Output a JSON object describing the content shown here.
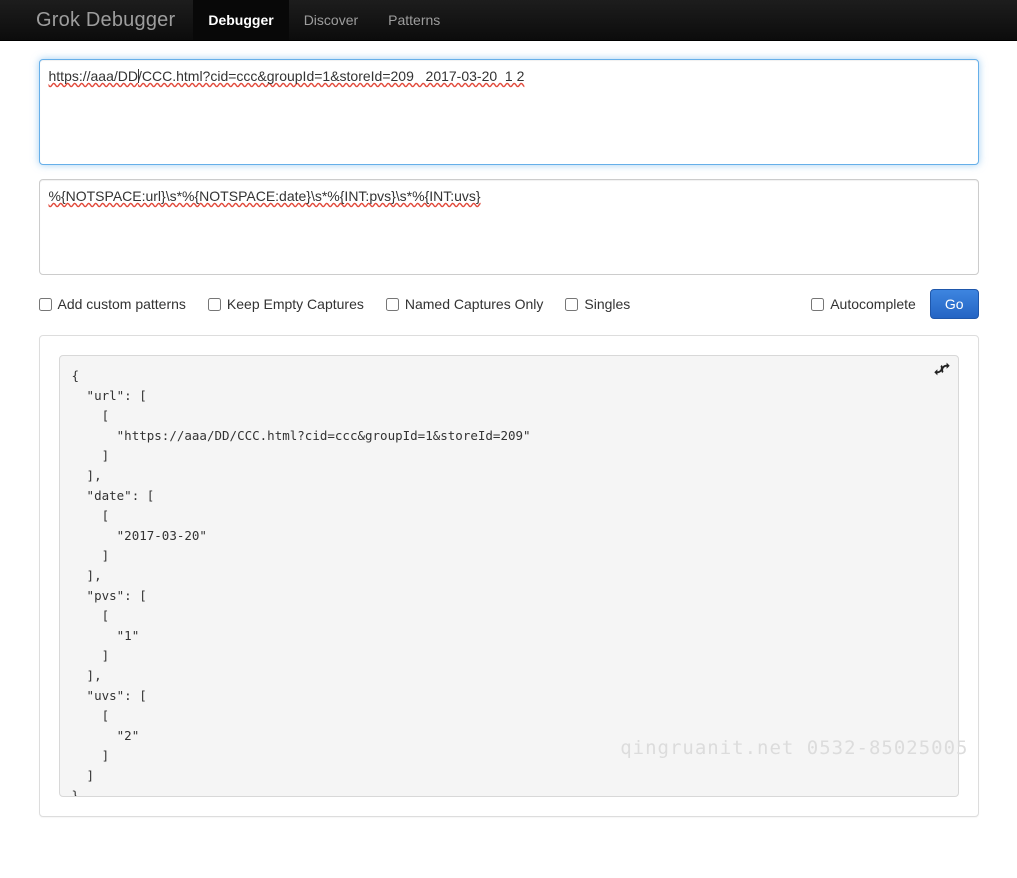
{
  "navbar": {
    "brand": "Grok Debugger",
    "tabs": [
      {
        "label": "Debugger",
        "active": true
      },
      {
        "label": "Discover",
        "active": false
      },
      {
        "label": "Patterns",
        "active": false
      }
    ]
  },
  "input_area": {
    "name": "sample-input-textarea",
    "value_before_caret": "https://aaa/DD",
    "value_after_caret": "/CCC.html?cid=ccc&groupId=1&storeId=209   2017-03-20  1 2",
    "full_value": "https://aaa/DD/CCC.html?cid=ccc&groupId=1&storeId=209   2017-03-20  1 2",
    "placeholder": ""
  },
  "pattern_area": {
    "name": "grok-pattern-textarea",
    "value": "%{NOTSPACE:url}\\s*%{NOTSPACE:date}\\s*%{INT:pvs}\\s*%{INT:uvs}",
    "placeholder": ""
  },
  "options": {
    "checkboxes": [
      {
        "label": "Add custom patterns",
        "checked": false
      },
      {
        "label": "Keep Empty Captures",
        "checked": false
      },
      {
        "label": "Named Captures Only",
        "checked": false
      },
      {
        "label": "Singles",
        "checked": false
      }
    ],
    "autocomplete": {
      "label": "Autocomplete",
      "checked": false
    },
    "go_label": "Go"
  },
  "output": {
    "refresh_icon": "refresh-icon",
    "text": "{\n  \"url\": [\n    [\n      \"https://aaa/DD/CCC.html?cid=ccc&groupId=1&storeId=209\"\n    ]\n  ],\n  \"date\": [\n    [\n      \"2017-03-20\"\n    ]\n  ],\n  \"pvs\": [\n    [\n      \"1\"\n    ]\n  ],\n  \"uvs\": [\n    [\n      \"2\"\n    ]\n  ]\n}",
    "parsed": {
      "url": [
        [
          "https://aaa/DD/CCC.html?cid=ccc&groupId=1&storeId=209"
        ]
      ],
      "date": [
        [
          "2017-03-20"
        ]
      ],
      "pvs": [
        [
          "1"
        ]
      ],
      "uvs": [
        [
          "2"
        ]
      ]
    }
  },
  "watermark": "qingruanit.net 0532-85025005",
  "colors": {
    "navbar_bg": "#141414",
    "accent_blue": "#2f72d4",
    "focus_border": "#66afe9",
    "panel_border": "#dddddd",
    "pre_bg": "#f5f5f5",
    "watermark": "#dcdcdc"
  }
}
